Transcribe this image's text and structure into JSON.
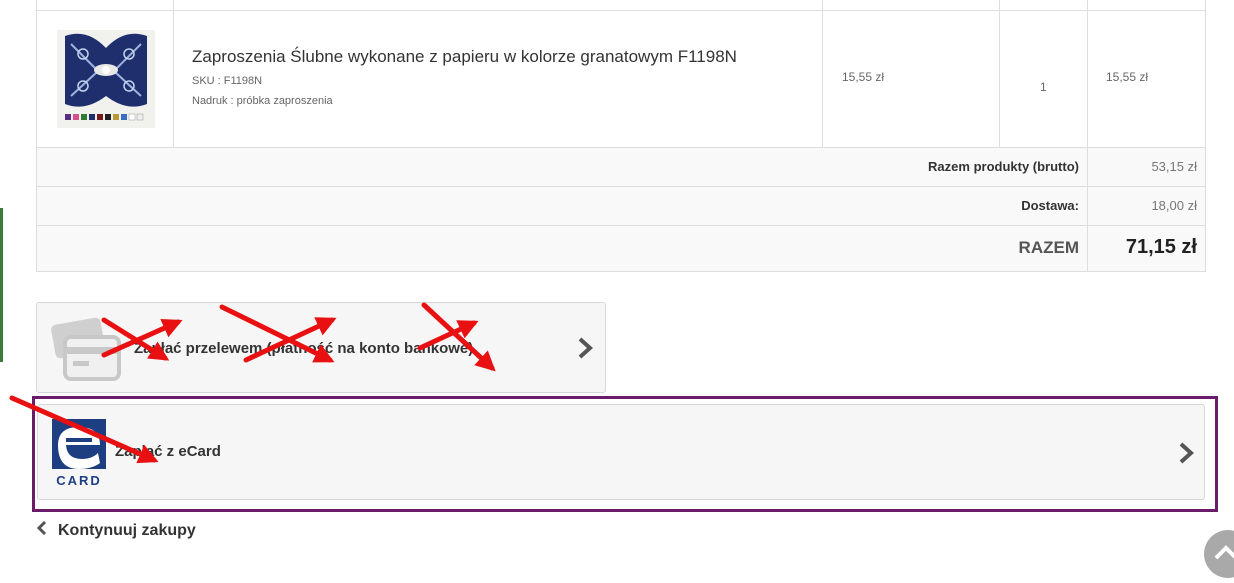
{
  "product": {
    "name": "Zaproszenia Ślubne wykonane z papieru w kolorze granatowym F1198N",
    "sku": "SKU : F1198N",
    "print": "Nadruk : próbka zaproszenia",
    "unit_price": "15,55 zł",
    "quantity": "1",
    "line_total": "15,55 zł",
    "thumbnail": "invitation-card-thumbnail"
  },
  "summary": {
    "subtotal_label": "Razem produkty (brutto)",
    "subtotal_value": "53,15 zł",
    "shipping_label": "Dostawa:",
    "shipping_value": "18,00 zł",
    "total_label": "RAZEM",
    "total_value": "71,15 zł"
  },
  "payment": {
    "transfer_label": "Zapłać przelewem (płatność na konto bankowe)",
    "transfer_icon": "credit-card-icon",
    "ecard_label": "Zapłać z eCard",
    "ecard_logo_text": "CARD",
    "ecard_icon": "ecard-logo"
  },
  "navigation": {
    "continue_label": "Kontynuuj zakupy"
  },
  "colors": {
    "annotation_arrows": "#e81010",
    "highlight_frame": "#6a1b6a",
    "ecard_blue": "#1d3f82"
  }
}
